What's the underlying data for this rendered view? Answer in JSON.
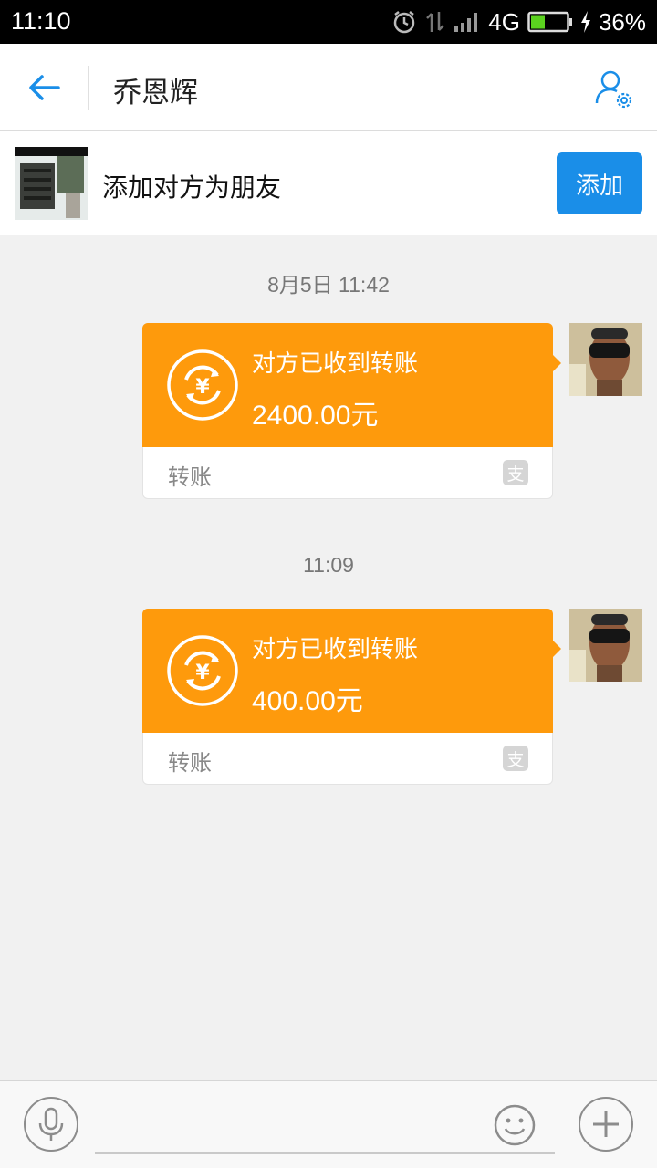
{
  "status_bar": {
    "time": "11:10",
    "network": "4G",
    "battery": "36%",
    "battery_level": 0.36,
    "icons": [
      "alarm-icon",
      "data-transfer-icon",
      "signal-icon",
      "battery-icon",
      "charging-icon"
    ]
  },
  "header": {
    "title": "乔恩辉",
    "icons": [
      "back-arrow-icon",
      "profile-settings-icon"
    ],
    "accent_color": "#1a8ee8"
  },
  "banner": {
    "text": "添加对方为朋友",
    "add_label": "添加"
  },
  "messages": [
    {
      "timestamp": "8月5日 11:42",
      "status": "对方已收到转账",
      "amount": "2400.00元",
      "footer_label": "转账",
      "footer_icon": "支"
    },
    {
      "timestamp": "11:09",
      "status": "对方已收到转账",
      "amount": "400.00元",
      "footer_label": "转账",
      "footer_icon": "支"
    }
  ],
  "colors": {
    "transfer_bubble": "#fe9a0c",
    "add_button": "#1a8ee8"
  },
  "input_bar": {
    "icons": [
      "microphone-icon",
      "emoji-icon",
      "plus-icon"
    ]
  }
}
